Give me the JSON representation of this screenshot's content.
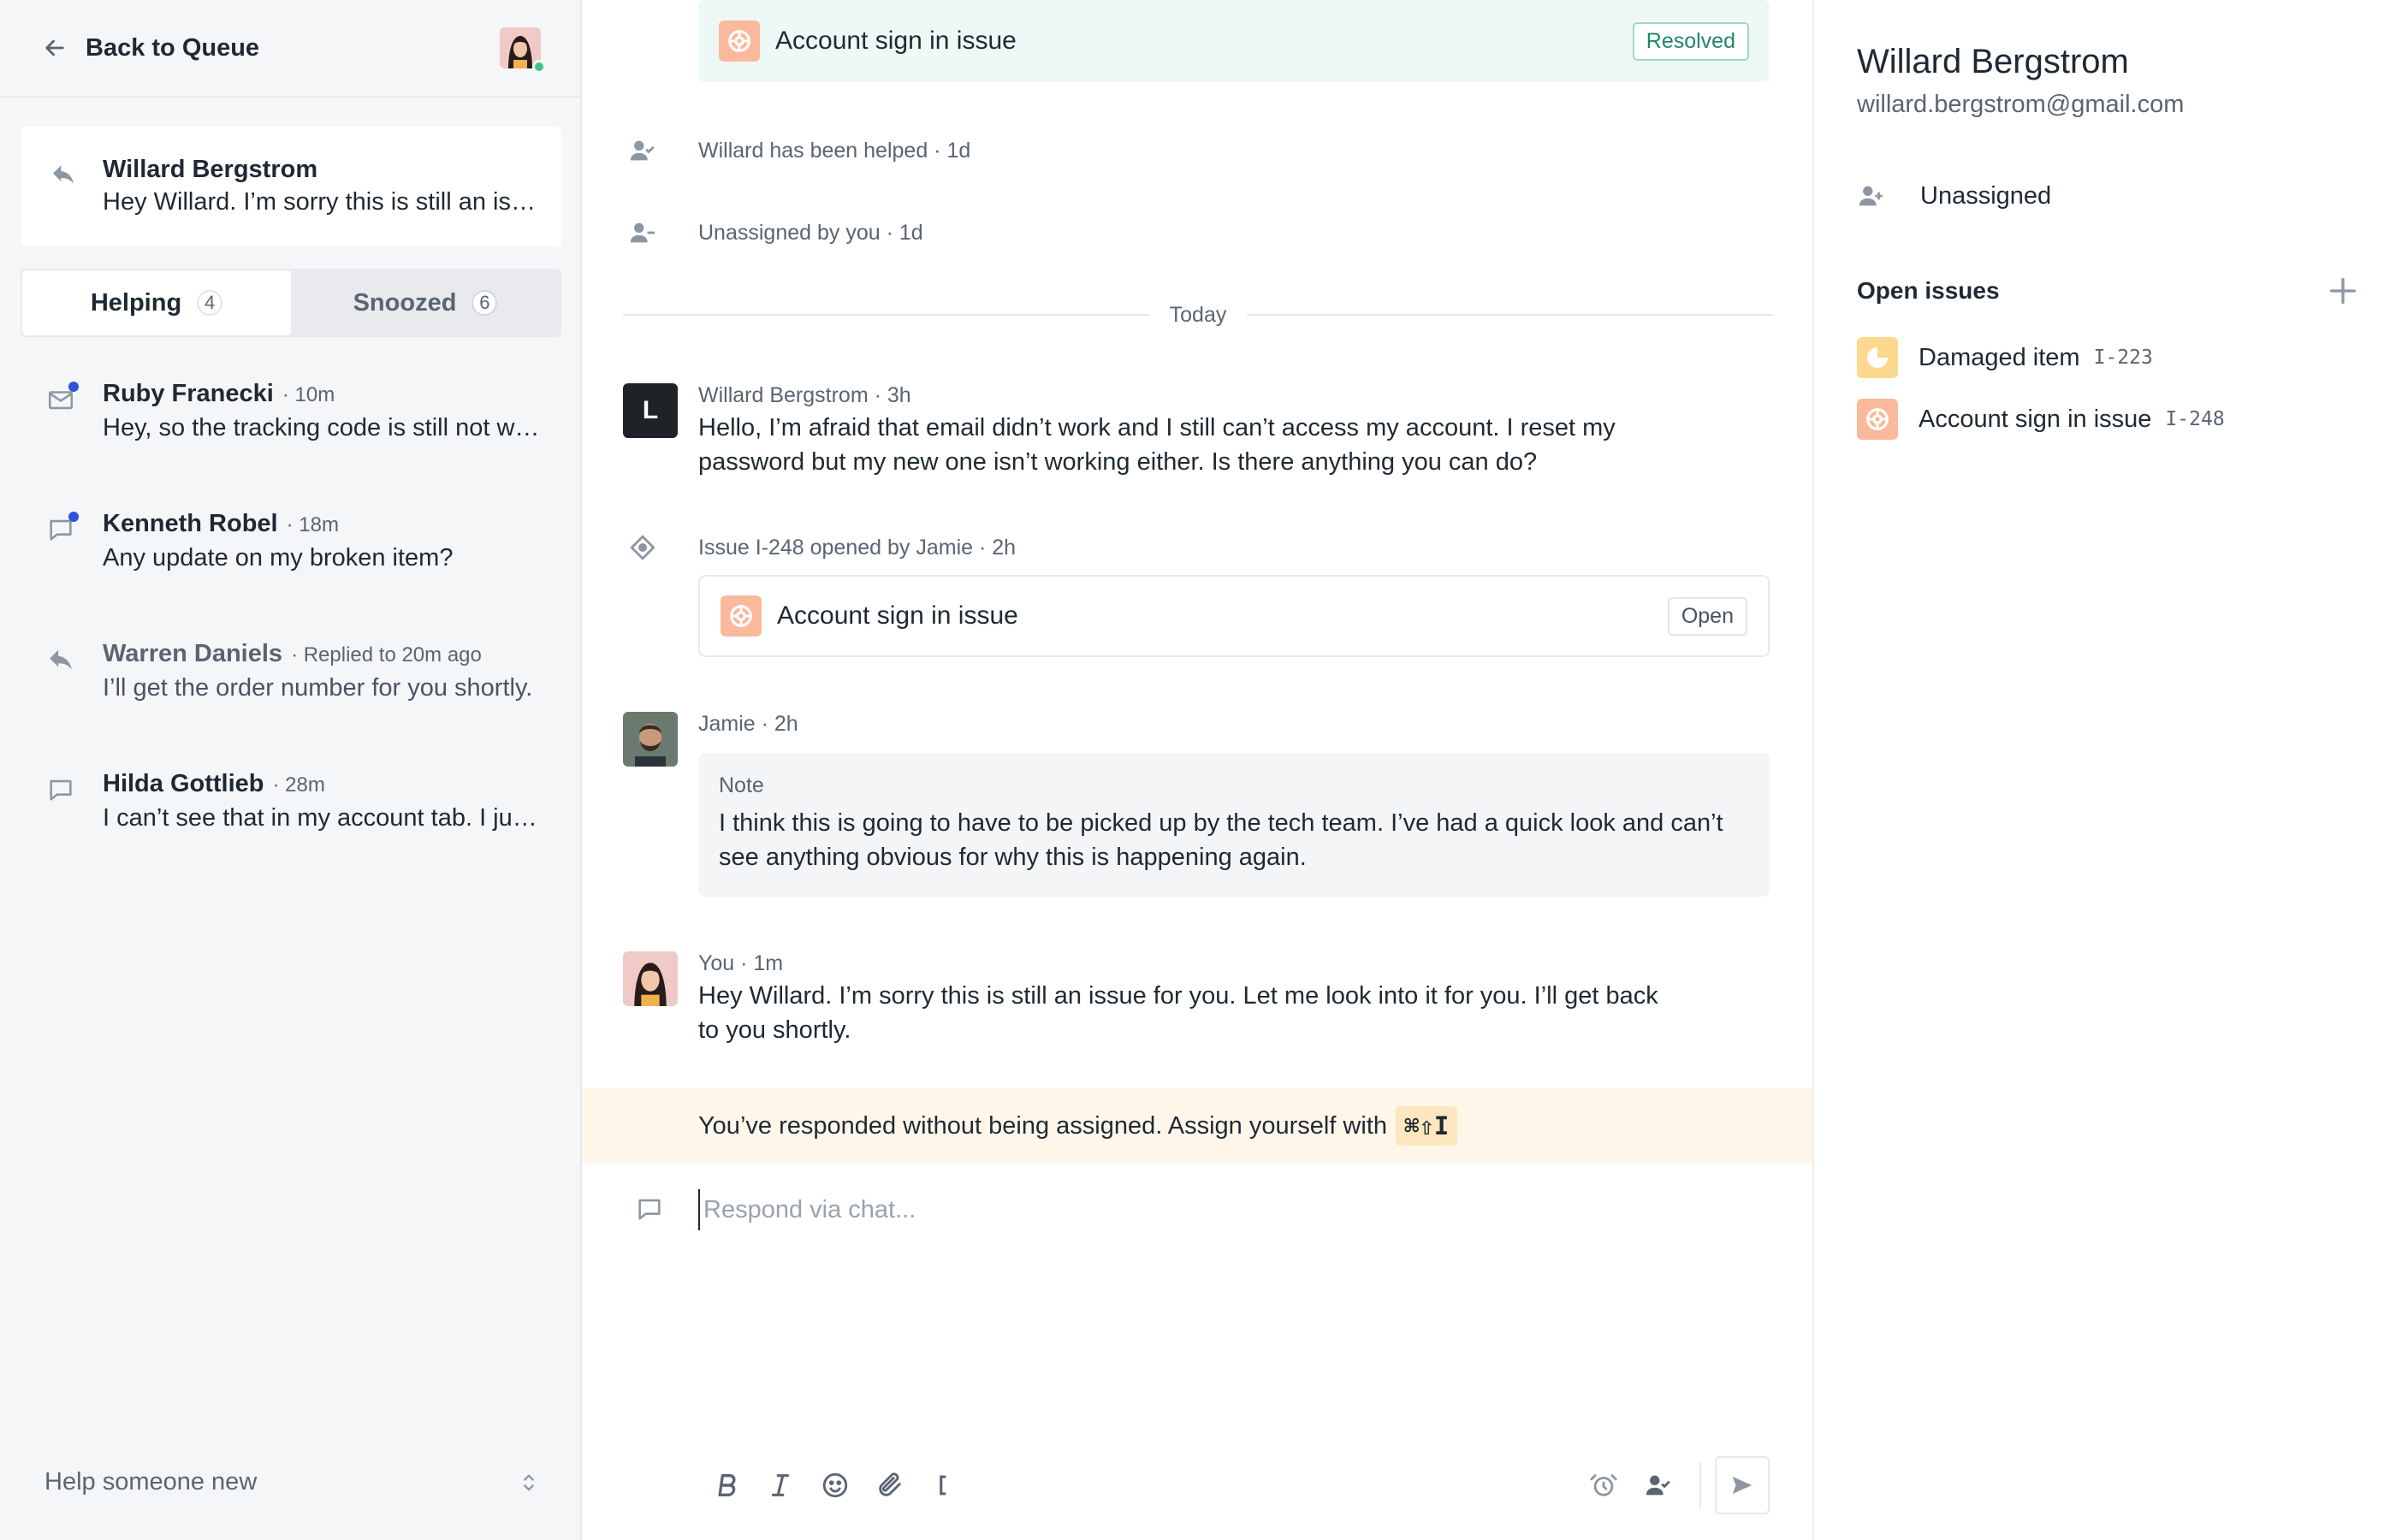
{
  "sidebar": {
    "back_label": "Back to Queue",
    "active_conversation": {
      "name": "Willard Bergstrom",
      "preview": "Hey Willard. I’m sorry this is still an issue for you. Let me look into it for you."
    },
    "tabs": [
      {
        "label": "Helping",
        "count": "4"
      },
      {
        "label": "Snoozed",
        "count": "6"
      }
    ],
    "conversations": [
      {
        "name": "Ruby Franecki",
        "meta": "· 10m",
        "preview": "Hey, so the tracking code is still not working for me",
        "icon": "email-icon",
        "unread": true
      },
      {
        "name": "Kenneth Robel",
        "meta": "· 18m",
        "preview": "Any update on my broken item?",
        "icon": "chat-icon",
        "unread": true
      },
      {
        "name": "Warren Daniels",
        "meta": "· Replied to 20m ago",
        "preview": "I’ll get the order number for you shortly.",
        "icon": "reply-icon",
        "unread": false
      },
      {
        "name": "Hilda Gottlieb",
        "meta": "· 28m",
        "preview": "I can’t see that in my account tab. I just see my orders.",
        "icon": "chat-icon",
        "unread": false
      }
    ],
    "help_new_label": "Help someone new"
  },
  "main": {
    "resolved_issue": {
      "title": "Account sign in issue",
      "status": "Resolved"
    },
    "events": [
      {
        "text": "Willard has been helped · 1d",
        "icon": "user-check-icon"
      },
      {
        "text": "Unassigned by you · 1d",
        "icon": "user-minus-icon"
      }
    ],
    "divider_label": "Today",
    "customer_message": {
      "avatar_letter": "L",
      "meta": "Willard Bergstrom · 3h",
      "body": "Hello, I’m afraid that email didn’t work and I still can’t access my account. I reset my password but my new one isn’t working either. Is there anything you can do?"
    },
    "issue_event": {
      "text": "Issue I-248 opened by Jamie · 2h"
    },
    "open_issue": {
      "title": "Account sign in issue",
      "status": "Open"
    },
    "note_message": {
      "meta": "Jamie · 2h",
      "label": "Note",
      "body": "I think this is going to have to be picked up by the tech team. I’ve had a quick look and can’t see anything obvious for why this is happening again."
    },
    "my_message": {
      "meta": "You · 1m",
      "body": "Hey Willard. I’m sorry this is still an issue for you. Let me look into it for you. I’ll get back to you shortly."
    },
    "warning": {
      "text": "You’ve responded without being assigned. Assign yourself with",
      "shortcut": "⌘⇧I"
    },
    "composer": {
      "placeholder": "Respond via chat..."
    }
  },
  "customer_panel": {
    "name": "Willard Bergstrom",
    "email": "willard.bergstrom@gmail.com",
    "assignee": "Unassigned",
    "open_issues_heading": "Open issues",
    "open_issues": [
      {
        "title": "Damaged item",
        "id": "I-223",
        "color": "yellow"
      },
      {
        "title": "Account sign in issue",
        "id": "I-248",
        "color": "orange"
      }
    ]
  },
  "colors": {
    "accent_blue": "#2f54d9",
    "resolved_green": "#21876a",
    "warning_bg": "#fff6ea",
    "issue_orange": "#fbb99c",
    "issue_yellow": "#fcd98f",
    "online_green": "#3cc48f"
  }
}
